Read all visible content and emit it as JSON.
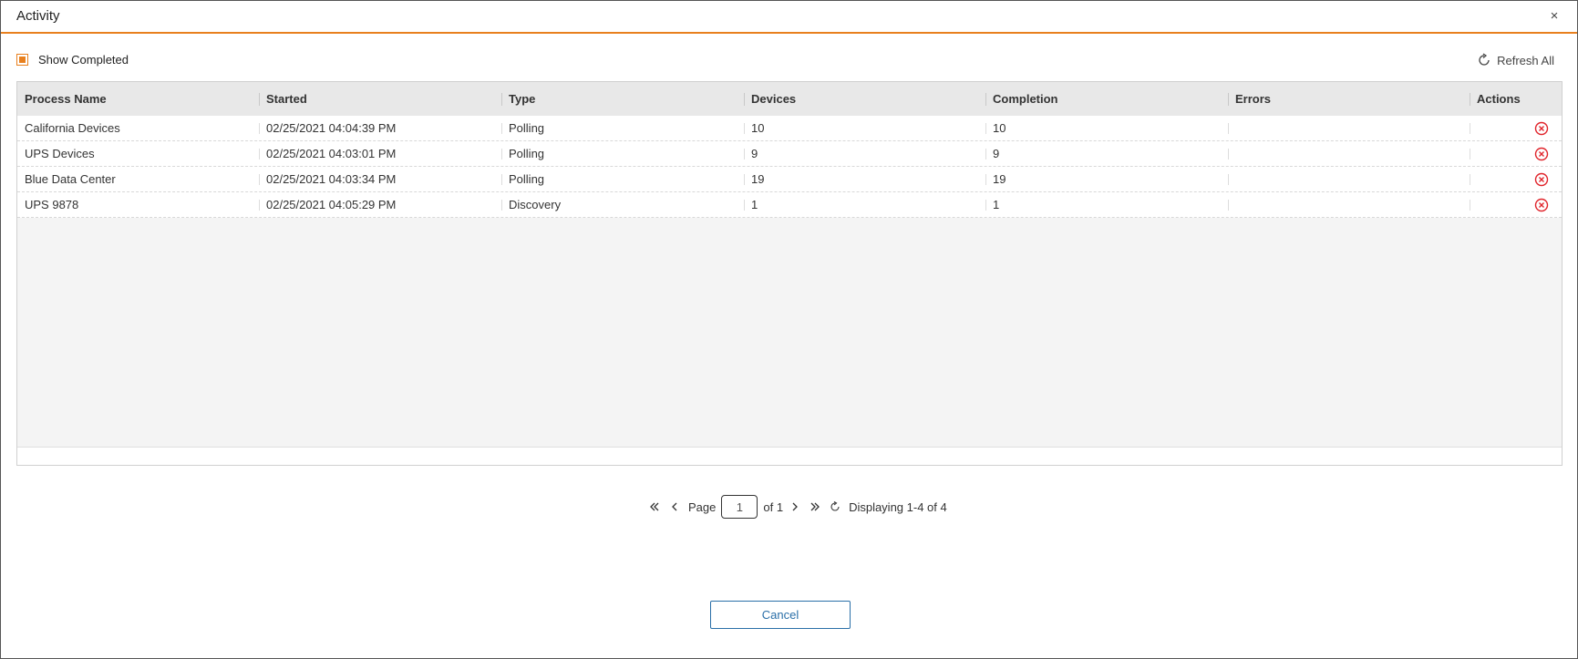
{
  "dialog": {
    "title": "Activity",
    "close_label": "×"
  },
  "toolbar": {
    "show_completed_label": "Show Completed",
    "show_completed_checked": true,
    "refresh_all_label": "Refresh All"
  },
  "table": {
    "columns": [
      "Process Name",
      "Started",
      "Type",
      "Devices",
      "Completion",
      "Errors",
      "Actions"
    ],
    "rows": [
      {
        "process_name": "California Devices",
        "started": "02/25/2021 04:04:39 PM",
        "type": "Polling",
        "devices": "10",
        "completion": "10",
        "errors": ""
      },
      {
        "process_name": "UPS Devices",
        "started": "02/25/2021 04:03:01 PM",
        "type": "Polling",
        "devices": "9",
        "completion": "9",
        "errors": ""
      },
      {
        "process_name": "Blue Data Center",
        "started": "02/25/2021 04:03:34 PM",
        "type": "Polling",
        "devices": "19",
        "completion": "19",
        "errors": ""
      },
      {
        "process_name": "UPS 9878",
        "started": "02/25/2021 04:05:29 PM",
        "type": "Discovery",
        "devices": "1",
        "completion": "1",
        "errors": ""
      }
    ],
    "action_icon": "cancel-circle-icon"
  },
  "pager": {
    "page_label": "Page",
    "current_page": "1",
    "of_label": "of 1",
    "display_label": "Displaying 1-4 of 4"
  },
  "footer": {
    "cancel_label": "Cancel"
  },
  "colors": {
    "accent": "#e8801e",
    "danger": "#e0242b",
    "primary": "#2a6fa8"
  }
}
